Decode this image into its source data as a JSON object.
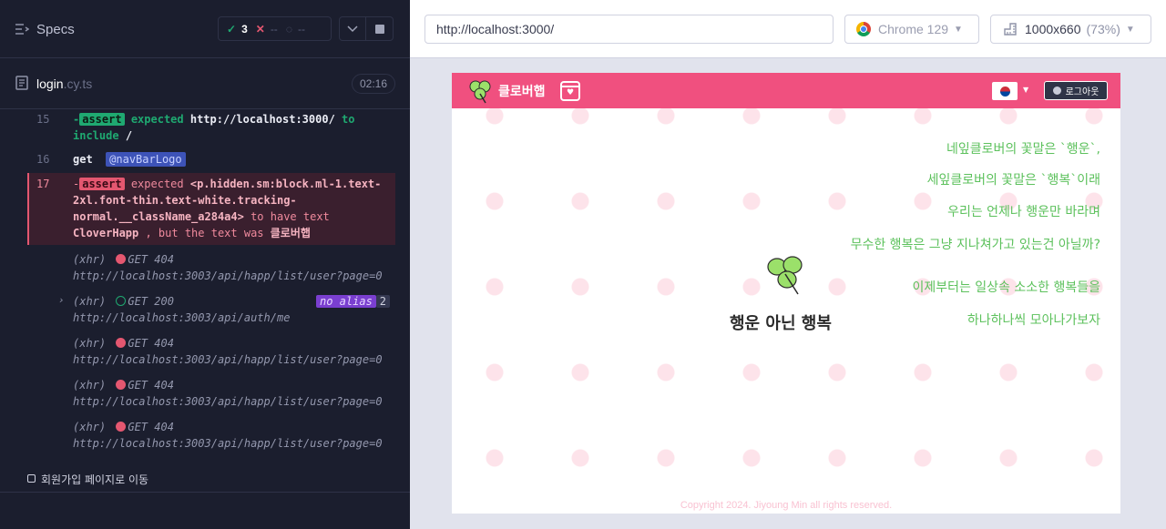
{
  "reporter": {
    "title": "Specs",
    "stats": {
      "passed": "3",
      "failed": "--",
      "pending": "--"
    },
    "file": {
      "name": "login",
      "ext": ".cy.ts",
      "duration": "02:16"
    },
    "commands": [
      {
        "num": "15",
        "prefix": "-",
        "type": "assert",
        "text": "expected",
        "a": "http://localhost:3000/",
        "mid": "to",
        "b": "include",
        "c": "/"
      },
      {
        "num": "16",
        "name": "get",
        "alias": "@navBarLogo"
      },
      {
        "num": "17",
        "prefix": "-",
        "type": "assert",
        "line1a": "expected",
        "line1b": "<p.hidden.sm:block.ml-1.text-",
        "line2": "2xl.font-thin.text-white.tracking-",
        "line3a": "normal.__className_a284a4>",
        "line3b": "to have text",
        "line4a": "CloverHapp",
        "line4b": ", but the text was",
        "line4c": "클로버햅"
      }
    ],
    "xhrs": [
      {
        "label": "(xhr)",
        "status": "GET 404",
        "url": "http://localhost:3003/api/happ/list/user?page=0"
      },
      {
        "label": "(xhr)",
        "status": "GET 200",
        "url": "http://localhost:3003/api/auth/me",
        "alias": "no alias",
        "count": "2"
      },
      {
        "label": "(xhr)",
        "status": "GET 404",
        "url": "http://localhost:3003/api/happ/list/user?page=0"
      },
      {
        "label": "(xhr)",
        "status": "GET 404",
        "url": "http://localhost:3003/api/happ/list/user?page=0"
      },
      {
        "label": "(xhr)",
        "status": "GET 404",
        "url": "http://localhost:3003/api/happ/list/user?page=0"
      }
    ],
    "next_test": "회원가입 페이지로 이동"
  },
  "aut": {
    "url": "http://localhost:3000/",
    "browser": "Chrome 129",
    "viewport": "1000x660",
    "scale": "(73%)"
  },
  "app": {
    "logo_text": "클로버햅",
    "logout_label": "로그아웃",
    "poem": [
      "네잎클로버의 꽃말은 `행운`,",
      "세잎클로버의 꽃말은 `행복`이래",
      "우리는 언제나 행운만 바라며",
      "무수한 행복은 그냥 지나쳐가고 있는건 아닐까?",
      "이제부터는 일상속 소소한 행복들을",
      "하나하나씩 모아나가보자"
    ],
    "tagline": "행운 아닌 행복",
    "copyright": "Copyright 2024. Jiyoung Min all rights reserved."
  },
  "colors": {
    "nav": "#f0507f",
    "pass": "#1fa971",
    "fail": "#e45770",
    "poem": "#5cc15c"
  }
}
